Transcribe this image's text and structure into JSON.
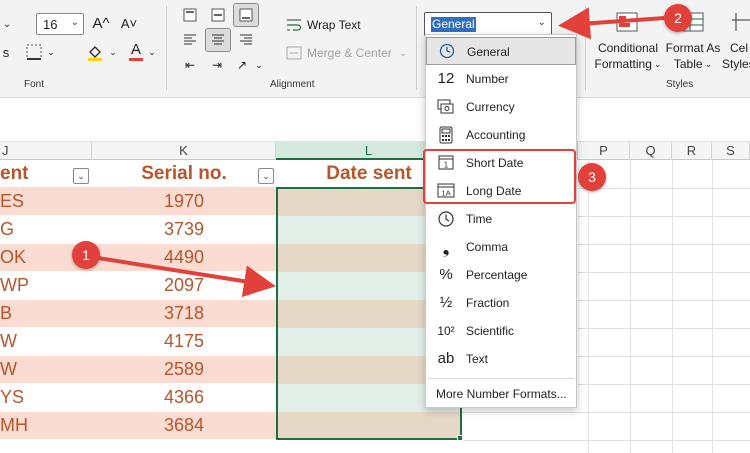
{
  "ribbon": {
    "font_size": "16",
    "font_group_label": "Font",
    "alignment_group_label": "Alignment",
    "styles_group_label": "Styles",
    "wrap_text_label": "Wrap Text",
    "merge_center_label": "Merge & Center",
    "number_format_value": "General",
    "conditional_formatting_line1": "Conditional",
    "conditional_formatting_line2": "Formatting",
    "format_as_table_line1": "Format As",
    "format_as_table_line2": "Table",
    "cell_styles_line1": "Cel",
    "cell_styles_line2": "Styles"
  },
  "columns": {
    "j": "J",
    "k": "K",
    "l": "L",
    "p": "P",
    "q": "Q",
    "r": "R",
    "s": "S"
  },
  "table": {
    "headers": [
      "ent",
      "Serial no.",
      "Date sent"
    ],
    "rows": [
      {
        "code": "ES",
        "serial": "1970"
      },
      {
        "code": "G",
        "serial": "3739"
      },
      {
        "code": "OK",
        "serial": "4490"
      },
      {
        "code": "WP",
        "serial": "2097"
      },
      {
        "code": "B",
        "serial": "3718"
      },
      {
        "code": "W",
        "serial": "4175"
      },
      {
        "code": "W",
        "serial": "2589"
      },
      {
        "code": "YS",
        "serial": "4366"
      },
      {
        "code": "MH",
        "serial": "3684"
      }
    ]
  },
  "number_format_menu": {
    "items": [
      {
        "label": "General",
        "icon": "general-clock-icon"
      },
      {
        "label": "Number",
        "icon": "number-12-icon"
      },
      {
        "label": "Currency",
        "icon": "currency-icon"
      },
      {
        "label": "Accounting",
        "icon": "accounting-calculator-icon"
      },
      {
        "label": "Short Date",
        "icon": "short-date-calendar-icon"
      },
      {
        "label": "Long Date",
        "icon": "long-date-calendar-icon"
      },
      {
        "label": "Time",
        "icon": "time-clock-icon"
      },
      {
        "label": "Comma",
        "icon": "comma-icon"
      },
      {
        "label": "Percentage",
        "icon": "percentage-icon"
      },
      {
        "label": "Fraction",
        "icon": "fraction-icon"
      },
      {
        "label": "Scientific",
        "icon": "scientific-icon"
      },
      {
        "label": "Text",
        "icon": "text-ab-icon"
      }
    ],
    "more_label": "More Number Formats..."
  },
  "icon_glyphs": {
    "number": "12",
    "comma": "❟",
    "percentage": "%",
    "fraction": "½",
    "scientific": "10²",
    "text": "ab",
    "font_bigger": "A^",
    "font_smaller": "A˅",
    "font_color": "A"
  },
  "annotations": {
    "callout_1": "1",
    "callout_2": "2",
    "callout_3": "3"
  },
  "colors": {
    "accent_red": "#e2403a",
    "salmon_row": "#fadcd2",
    "tan_row": "#e6d8c6",
    "mint_row": "#e2efe8",
    "excel_green": "#1f6e43",
    "text_orange": "#b5562c"
  }
}
